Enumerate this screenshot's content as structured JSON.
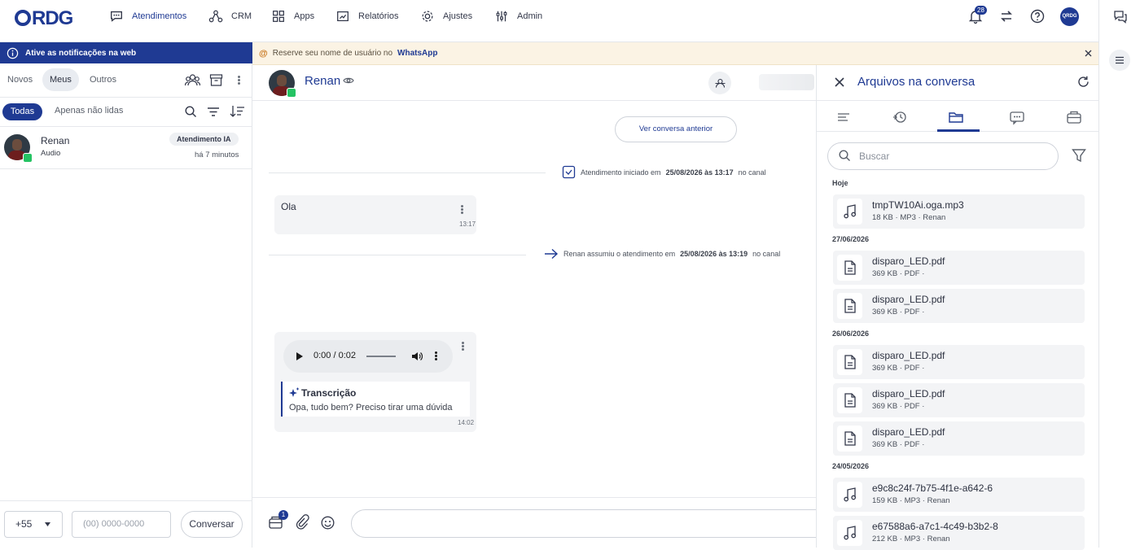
{
  "nav": {
    "logo": "QRDG",
    "items": [
      {
        "label": "Atendimentos",
        "icon": "chat-icon",
        "active": true
      },
      {
        "label": "CRM",
        "icon": "crm-icon"
      },
      {
        "label": "Apps",
        "icon": "apps-icon"
      },
      {
        "label": "Relatórios",
        "icon": "reports-icon"
      },
      {
        "label": "Ajustes",
        "icon": "gear-icon"
      },
      {
        "label": "Admin",
        "icon": "admin-icon"
      }
    ],
    "notifications_count": "28",
    "avatar_text": "QRDG"
  },
  "left": {
    "notif_text": "Ative as notificações na web",
    "tabs": [
      "Novos",
      "Meus",
      "Outros"
    ],
    "selected_tab": "Meus",
    "filter_all": "Todas",
    "filter_unread": "Apenas não lidas",
    "chat": {
      "name": "Renan",
      "preview": "Audio",
      "badge": "Atendimento IA",
      "time": "há 7 minutos"
    },
    "ddi": "+55",
    "phone_placeholder": "(00) 0000-0000",
    "start_button": "Conversar"
  },
  "banner": {
    "text": "Reserve seu nome de usuário no",
    "link": "WhatsApp"
  },
  "chat": {
    "contact_name": "Renan",
    "previous_button": "Ver conversa anterior",
    "sys1": {
      "prefix": "Atendimento iniciado em",
      "date": "25/08/2026 às 13:17",
      "suffix": "no canal"
    },
    "sys2": {
      "prefix": "Renan assumiu o atendimento em",
      "date": "25/08/2026 às 13:19",
      "suffix": "no canal"
    },
    "msg1": {
      "text": "Ola",
      "time": "13:17"
    },
    "msg2": {
      "audio_time": "0:00 / 0:02",
      "transcription_title": "Transcrição",
      "transcription_text": "Opa, tudo bem? Preciso tirar uma dúvida",
      "time": "14:02"
    },
    "attach_count": "1"
  },
  "files_panel": {
    "title": "Arquivos na conversa",
    "search_placeholder": "Buscar",
    "groups": [
      {
        "date": "Hoje",
        "files": [
          {
            "name": "tmpTW10Ai.oga.mp3",
            "meta": "18 KB · MP3 · Renan",
            "type": "audio"
          }
        ]
      },
      {
        "date": "27/06/2026",
        "files": [
          {
            "name": "disparo_LED.pdf",
            "meta": "369 KB · PDF ·",
            "type": "pdf"
          },
          {
            "name": "disparo_LED.pdf",
            "meta": "369 KB · PDF ·",
            "type": "pdf"
          }
        ]
      },
      {
        "date": "26/06/2026",
        "files": [
          {
            "name": "disparo_LED.pdf",
            "meta": "369 KB · PDF ·",
            "type": "pdf"
          },
          {
            "name": "disparo_LED.pdf",
            "meta": "369 KB · PDF ·",
            "type": "pdf"
          },
          {
            "name": "disparo_LED.pdf",
            "meta": "369 KB · PDF ·",
            "type": "pdf"
          }
        ]
      },
      {
        "date": "24/05/2026",
        "files": [
          {
            "name": "e9c8c24f-7b75-4f1e-a642-6",
            "meta": "159 KB · MP3 · Renan",
            "type": "audio"
          },
          {
            "name": "e67588a6-a7c1-4c49-b3b2-8",
            "meta": "212 KB · MP3 · Renan",
            "type": "audio"
          }
        ]
      }
    ]
  },
  "colors": {
    "brand": "#1f3a93",
    "whatsapp": "#25c363",
    "banner_bg": "#fbf3e4"
  }
}
